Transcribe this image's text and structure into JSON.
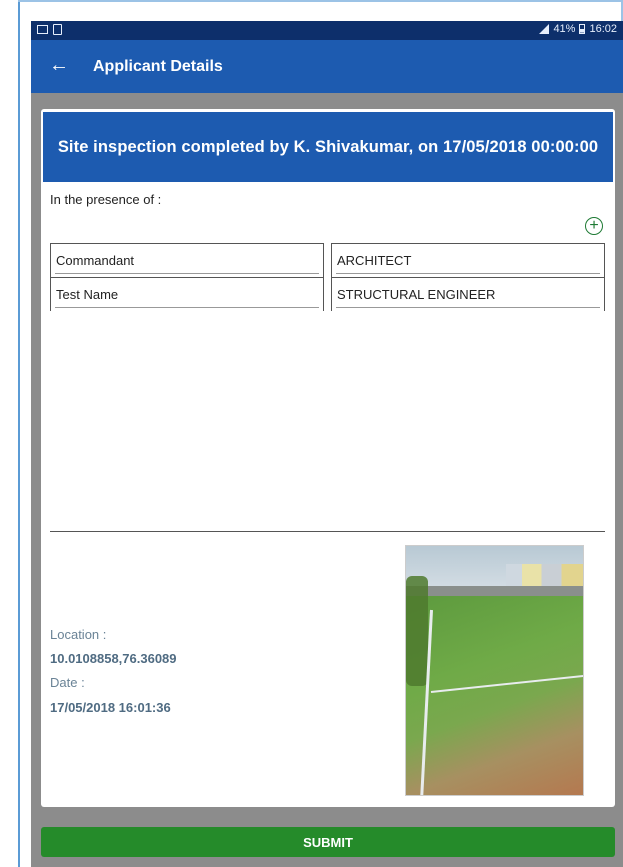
{
  "status_bar": {
    "battery": "41%",
    "time": "16:02"
  },
  "app_bar": {
    "back_icon": "arrow-left-icon",
    "title": "Applicant Details"
  },
  "inspection": {
    "banner": "Site inspection completed by K. Shivakumar, on 17/05/2018 00:00:00",
    "presence_label": "In the presence of :",
    "add_icon": "plus-circle-icon",
    "attendees": [
      {
        "name": "Commandant",
        "role": "ARCHITECT"
      },
      {
        "name": "Test Name",
        "role": "STRUCTURAL ENGINEER"
      }
    ]
  },
  "details": {
    "location_label": "Location :",
    "location_value": "10.0108858,76.36089",
    "date_label": "Date :",
    "date_value": "17/05/2018 16:01:36"
  },
  "colors": {
    "app_bar": "#1d5bb0",
    "status_bar": "#0d2f6b",
    "submit": "#258b2a"
  },
  "submit_label": "SUBMIT"
}
